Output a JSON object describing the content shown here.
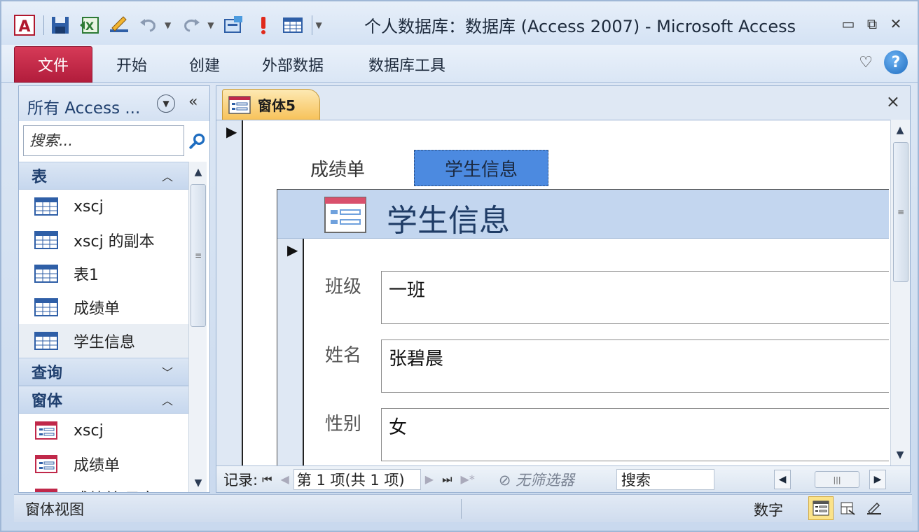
{
  "window": {
    "title": "个人数据库：数据库 (Access 2007)  -  Microsoft Access"
  },
  "ribbon": {
    "file_tab": "文件",
    "tabs": [
      "开始",
      "创建",
      "外部数据",
      "数据库工具"
    ]
  },
  "nav_pane": {
    "title": "所有 Access ...",
    "collapse_glyph": "«",
    "search_placeholder": "搜索...",
    "groups": [
      {
        "label": "表",
        "chevron": "⌃",
        "items": [
          "xscj",
          "xscj 的副本",
          "表1",
          "成绩单",
          "学生信息"
        ]
      },
      {
        "label": "查询",
        "chevron": "⌄",
        "items": []
      },
      {
        "label": "窗体",
        "chevron": "⌃",
        "items": [
          "xscj",
          "成绩单",
          "成绩单 子窗"
        ]
      }
    ],
    "selected_item": "学生信息"
  },
  "document": {
    "tab_label": "窗体5",
    "close_glyph": "×",
    "label_score": "成绩单",
    "button_student": "学生信息",
    "subform": {
      "header_title": "学生信息",
      "fields": [
        {
          "label": "班级",
          "value": "一班"
        },
        {
          "label": "姓名",
          "value": "张碧晨"
        },
        {
          "label": "性别",
          "value": "女"
        }
      ]
    },
    "record_nav": {
      "label": "记录:",
      "current": "第 1 项(共 1 项)",
      "filter": "无筛选器",
      "search": "搜索"
    }
  },
  "status_bar": {
    "view_name": "窗体视图",
    "num_lock": "数字"
  },
  "colors": {
    "file_tab": "#c0284a",
    "selected_button": "#4c8ae0",
    "subform_header": "#c3d6ef",
    "active_view": "#fbe38a"
  }
}
